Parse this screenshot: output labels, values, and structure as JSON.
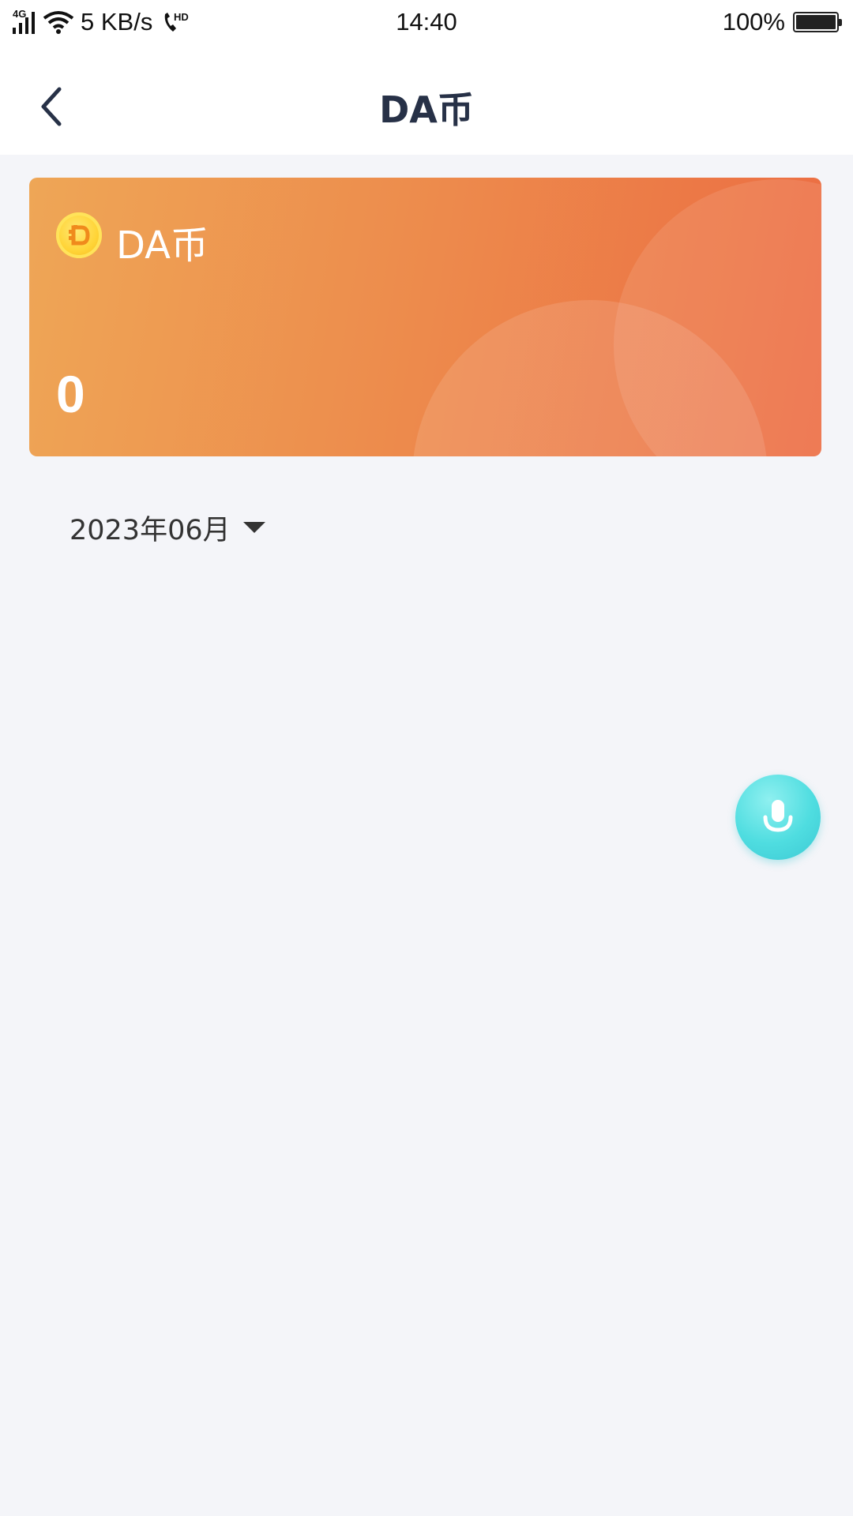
{
  "status_bar": {
    "network": "4G",
    "speed": "5 KB/s",
    "call_badge": "HD",
    "time": "14:40",
    "battery": "100%",
    "battery_level": 1.0,
    "icons": [
      "signal-icon",
      "wifi-icon",
      "hd-call-icon",
      "battery-icon"
    ]
  },
  "nav": {
    "title": "DA币",
    "back_icon": "chevron-left-icon"
  },
  "card": {
    "label": "DA币",
    "balance": "0",
    "coin_icon": "coin-icon",
    "colors": {
      "gradient_start": "#eea656",
      "gradient_end": "#ec6c42"
    }
  },
  "filter": {
    "month": "2023年06月",
    "dropdown_icon": "caret-down-icon"
  },
  "fab": {
    "icon": "microphone-icon",
    "color": "#4fdde0"
  },
  "colors": {
    "background": "#f4f5f9",
    "title": "#273147"
  }
}
